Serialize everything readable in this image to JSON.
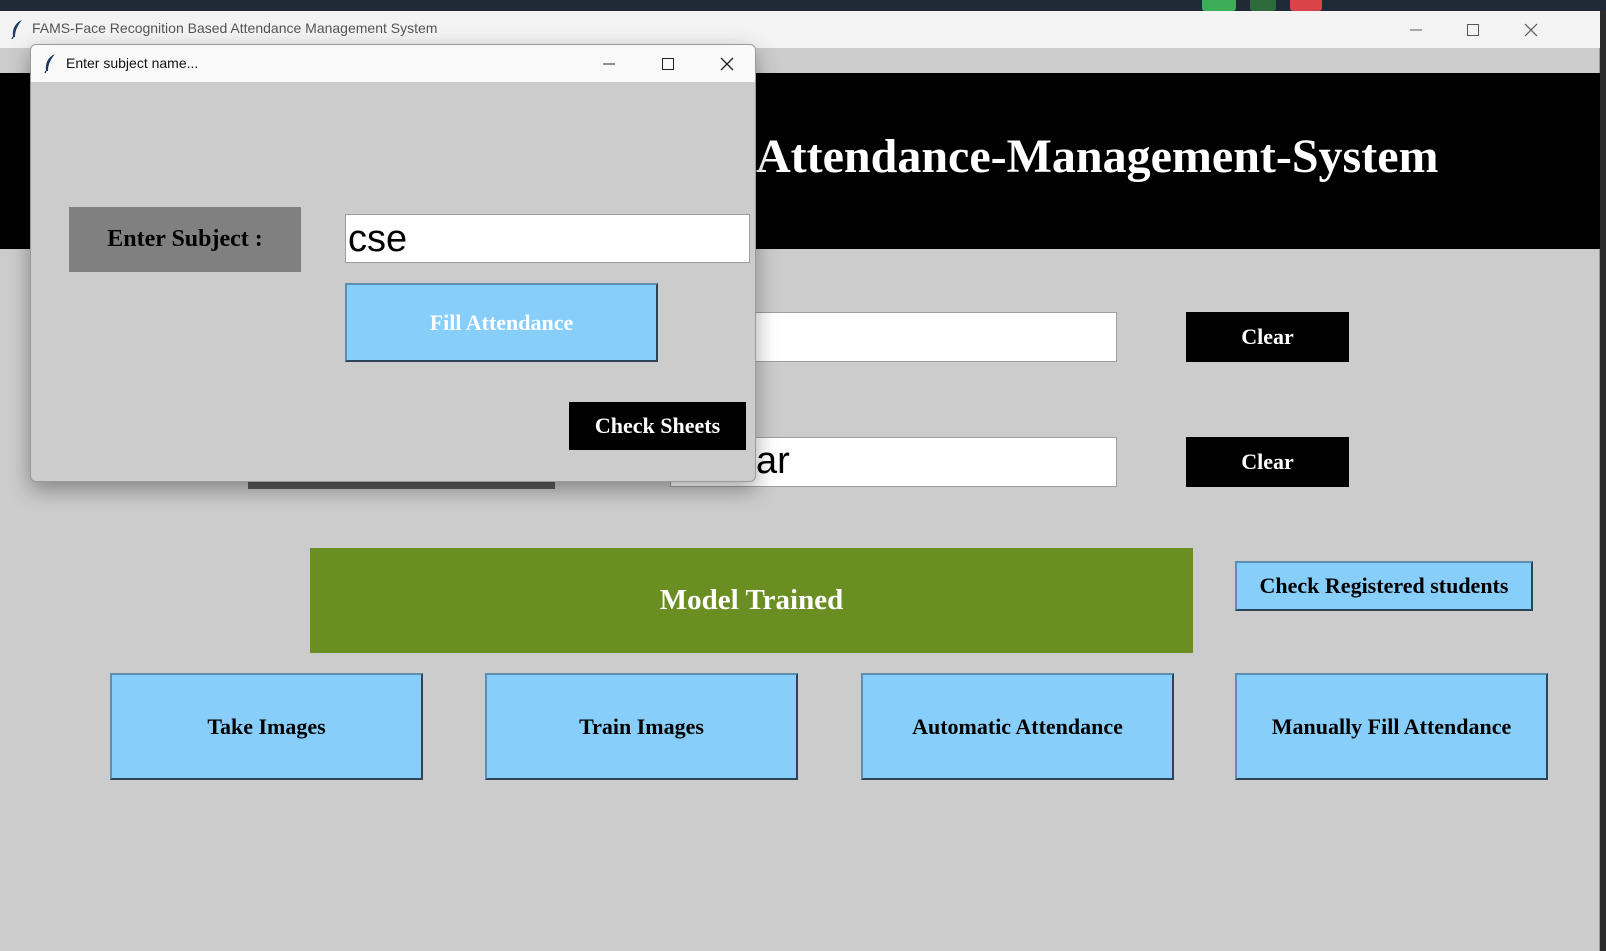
{
  "colors": {
    "banner_bg": "#000000",
    "button_blue": "#87cefa",
    "status_green": "#6b8e23",
    "window_bg": "#cccccc",
    "label_gray": "#808080"
  },
  "main_window": {
    "title": "FAMS-Face Recognition Based Attendance Management System",
    "app_icon": "feather-icon",
    "banner_title": "-Attendance-Management-System",
    "enrollment_input_value": "",
    "name_input_value": "kar",
    "clear_label_1": "Clear",
    "clear_label_2": "Clear",
    "status_message": "Model Trained",
    "check_registered_label": "Check Registered students",
    "take_images_label": "Take Images",
    "train_images_label": "Train Images",
    "automatic_attendance_label": "Automatic Attendance",
    "manual_attendance_label": "Manually Fill Attendance"
  },
  "dialog": {
    "title": "Enter subject name...",
    "app_icon": "feather-icon",
    "subject_label": "Enter Subject :",
    "subject_value": "cse",
    "fill_attendance_label": "Fill Attendance",
    "check_sheets_label": "Check Sheets"
  }
}
